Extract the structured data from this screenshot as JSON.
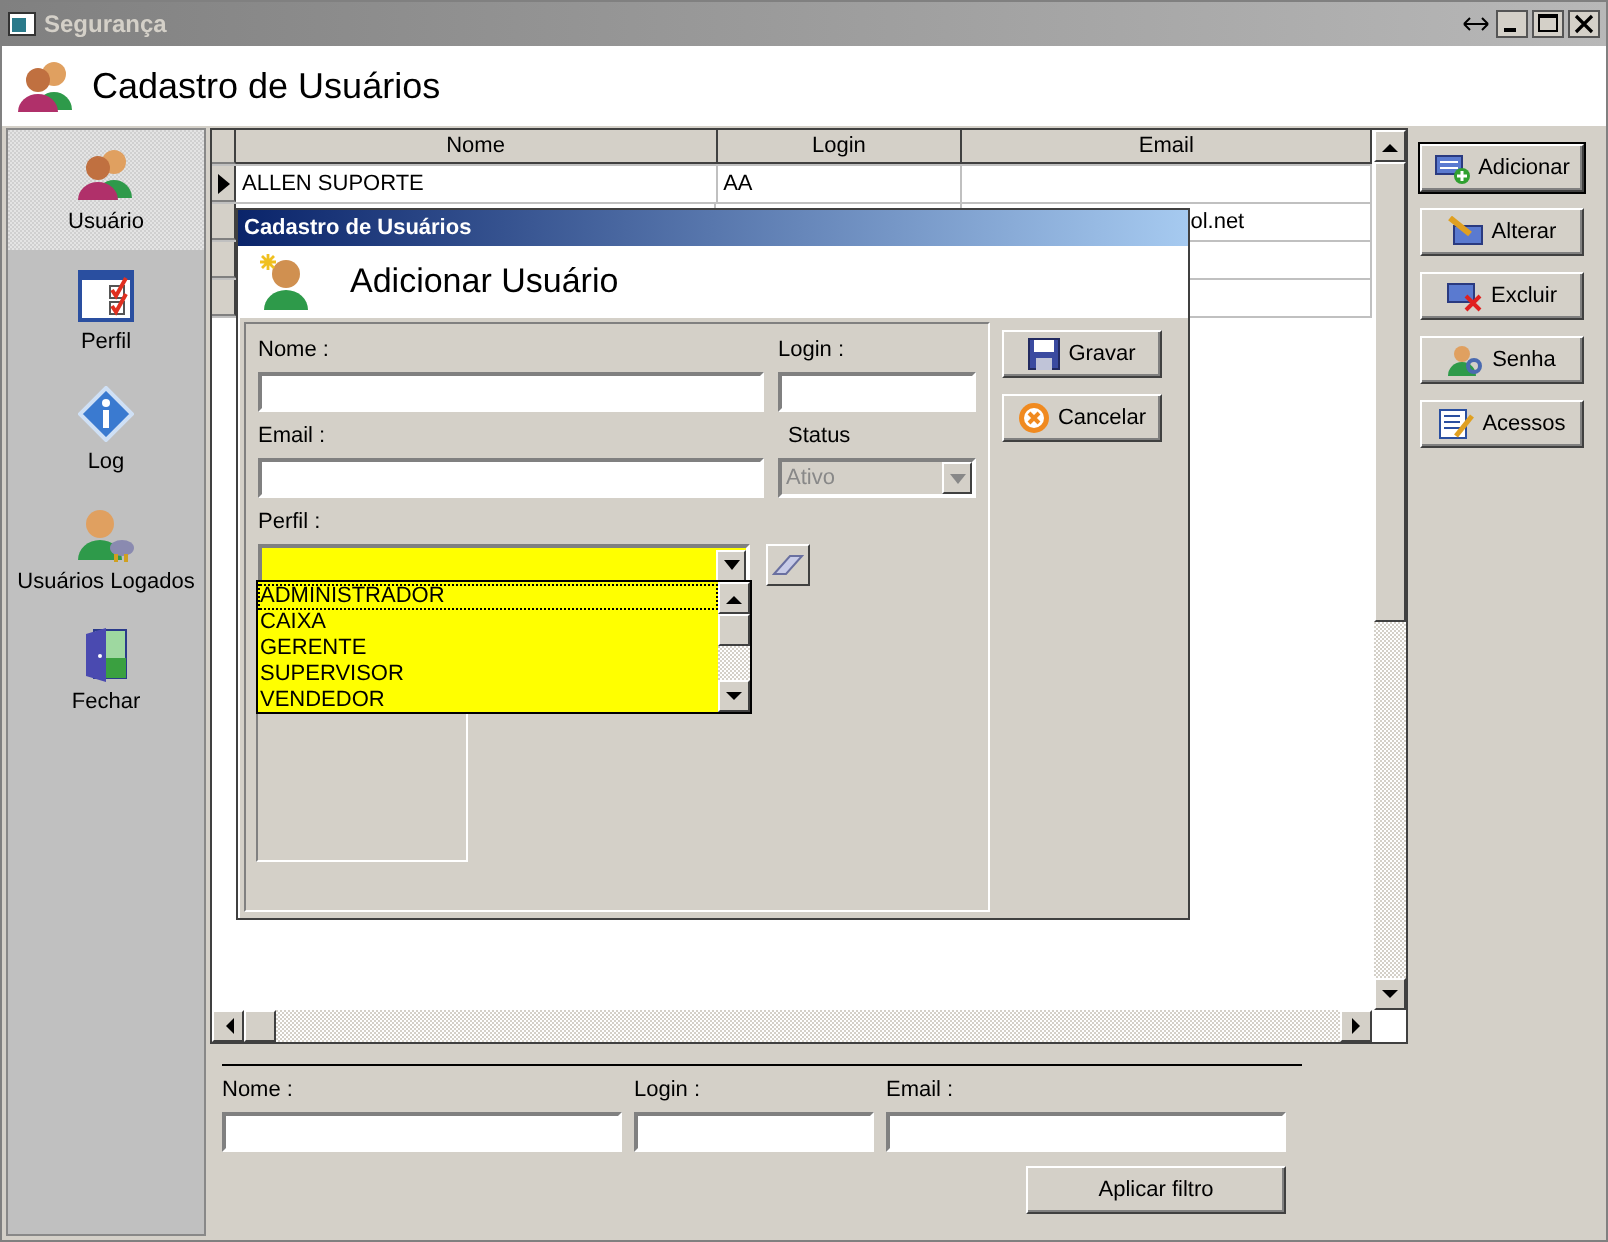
{
  "window": {
    "title": "Segurança"
  },
  "header": {
    "title": "Cadastro de Usuários"
  },
  "sidebar": {
    "items": [
      {
        "label": "Usuário",
        "selected": true
      },
      {
        "label": "Perfil",
        "selected": false
      },
      {
        "label": "Log",
        "selected": false
      },
      {
        "label": "Usuários Logados",
        "selected": false
      },
      {
        "label": "Fechar",
        "selected": false
      }
    ]
  },
  "table": {
    "columns": [
      "Nome",
      "Login",
      "Email"
    ],
    "rows": [
      {
        "current": true,
        "nome": "ALLEN SUPORTE",
        "login": "AA"
      },
      {
        "current": false,
        "email": "ol.net"
      },
      {
        "current": false
      },
      {
        "current": false
      }
    ]
  },
  "actions": [
    {
      "label": "Adicionar",
      "default": true
    },
    {
      "label": "Alterar",
      "default": false
    },
    {
      "label": "Excluir",
      "default": false
    },
    {
      "label": "Senha",
      "default": false
    },
    {
      "label": "Acessos",
      "default": false
    }
  ],
  "dialog": {
    "title": "Cadastro de Usuários",
    "heading": "Adicionar Usuário",
    "nome_label": "Nome :",
    "login_label": "Login :",
    "email_label": "Email :",
    "status": {
      "label": "Status",
      "value": "Ativo",
      "disabled": true
    },
    "perfil": {
      "label": "Perfil :",
      "options": [
        {
          "label": "ADMINISTRADOR",
          "selected": true
        },
        {
          "label": "CAIXA",
          "selected": false
        },
        {
          "label": "GERENTE",
          "selected": false
        },
        {
          "label": "SUPERVISOR",
          "selected": false
        },
        {
          "label": "VENDEDOR",
          "selected": false
        }
      ]
    },
    "buttons": [
      "Gravar",
      "Cancelar"
    ]
  },
  "filter": {
    "labels": [
      "Nome :",
      "Login :",
      "Email :"
    ],
    "button": "Aplicar filtro"
  }
}
